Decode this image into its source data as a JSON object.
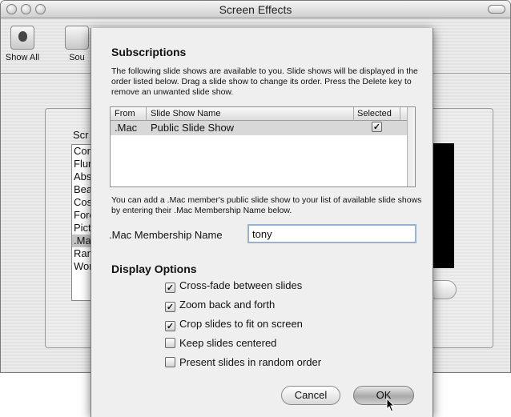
{
  "window": {
    "title": "Screen Effects"
  },
  "toolbar": {
    "items": [
      {
        "label": "Show All",
        "icon": "apple-prefs-icon"
      },
      {
        "label": "Sou",
        "icon": "speaker-icon"
      }
    ]
  },
  "background": {
    "list_label": "Scr",
    "list_items": [
      "Cor",
      "Flur",
      "Abs",
      "Bea",
      "Cos",
      "Fore",
      "Pict",
      ".Ma",
      "Ran",
      "Wor"
    ],
    "selected_index": 7
  },
  "sheet": {
    "title": "Subscriptions",
    "description": "The following slide shows are available to you. Slide shows will be displayed in the order listed below. Drag a slide show to change its order. Press the Delete key to remove an unwanted slide show.",
    "table": {
      "columns": [
        "From",
        "Slide Show Name",
        "Selected"
      ],
      "rows": [
        {
          "from": ".Mac",
          "name": "Public Slide Show",
          "selected": true
        }
      ]
    },
    "description2": "You can add a .Mac member's public slide show to your list of available slide shows by entering their .Mac Membership Name below.",
    "membership_label": ".Mac Membership Name",
    "membership_value": "tony",
    "display_options_title": "Display Options",
    "options": [
      {
        "label": "Cross-fade between slides",
        "checked": true
      },
      {
        "label": "Zoom back and forth",
        "checked": true
      },
      {
        "label": "Crop slides to fit on screen",
        "checked": true
      },
      {
        "label": "Keep slides centered",
        "checked": false
      },
      {
        "label": "Present slides in random order",
        "checked": false
      }
    ],
    "cancel_label": "Cancel",
    "ok_label": "OK"
  },
  "colors": {
    "default_button": "#a9a9a9",
    "selection": "#d8d8d8"
  }
}
